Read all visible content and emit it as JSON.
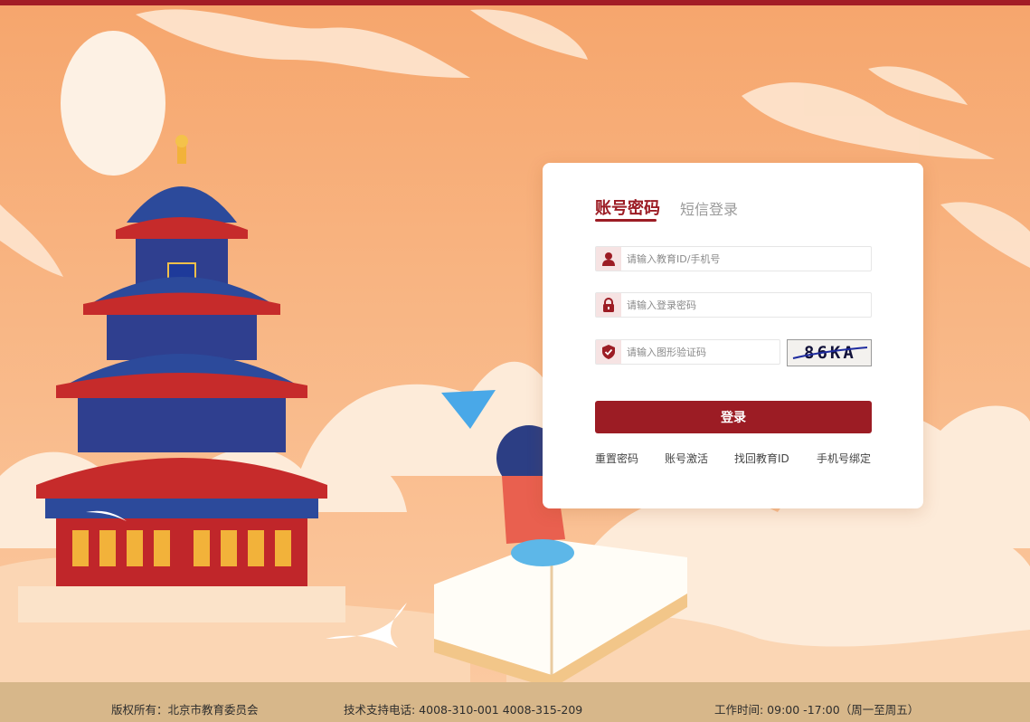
{
  "login": {
    "tabs": [
      "账号密码",
      "短信登录"
    ],
    "account_placeholder": "请输入教育ID/手机号",
    "password_placeholder": "请输入登录密码",
    "captcha_placeholder": "请输入图形验证码",
    "captcha_text": "86KA",
    "submit_label": "登录",
    "links": [
      "重置密码",
      "账号激活",
      "找回教育ID",
      "手机号绑定"
    ]
  },
  "footer": {
    "copyright": "版权所有：北京市教育委员会",
    "support": "技术支持电话: 4008-310-001 4008-315-209",
    "hours": "工作时间: 09:00 -17:00（周一至周五）"
  },
  "colors": {
    "brand": "#9c1c24",
    "background": "#f7b582",
    "footer": "#d7b78a"
  },
  "icons": {
    "account": "user-icon",
    "password": "lock-icon",
    "captcha": "shield-icon"
  }
}
